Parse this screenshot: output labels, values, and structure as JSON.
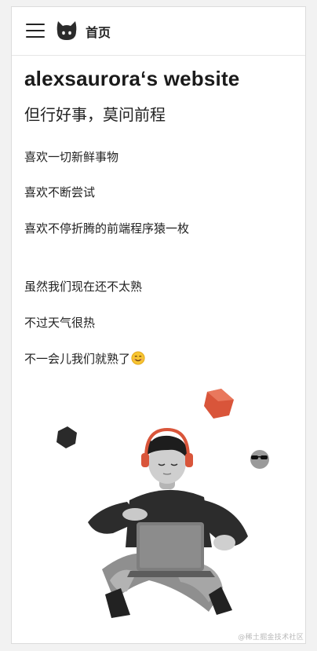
{
  "header": {
    "menu_icon": "hamburger-menu-icon",
    "logo_icon": "github-octocat-icon",
    "home_label": "首页"
  },
  "main": {
    "title": "alexsaurora‘s website",
    "subtitle": "但行好事，莫问前程",
    "lines": [
      "喜欢一切新鲜事物",
      "喜欢不断尝试",
      "喜欢不停折腾的前端程序猿一枚",
      "虽然我们现在还不太熟",
      "不过天气很热",
      "不一会儿我们就熟了"
    ],
    "emoji_icon": "smiling-face-emoji-icon"
  },
  "watermark": "@稀土掘金技术社区",
  "colors": {
    "accent_orange": "#d9553a",
    "text": "#222222"
  }
}
